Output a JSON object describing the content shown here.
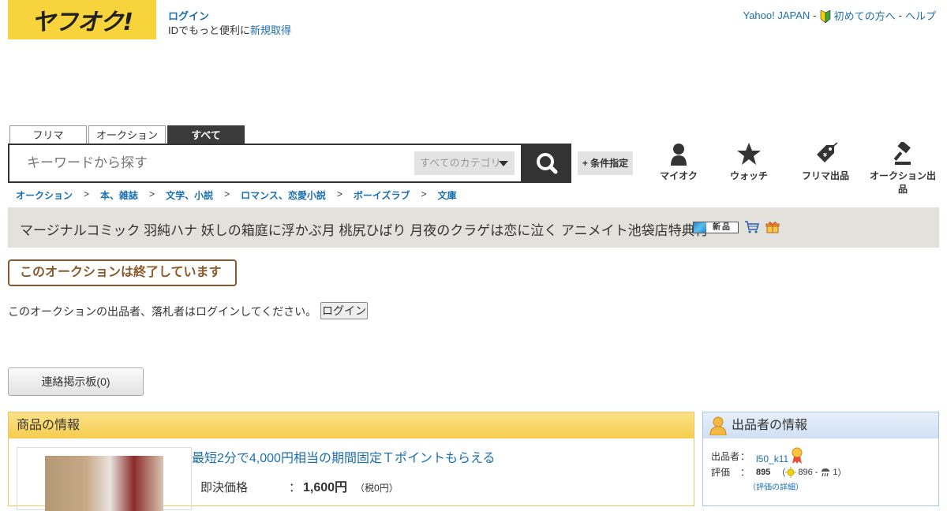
{
  "header": {
    "logo_text": "ヤフオク!",
    "login_label": "ログイン",
    "login_sub_text": "IDでもっと便利に",
    "register_label": "新規取得",
    "yahoo_japan_label": "Yahoo! JAPAN",
    "beginner_label": "初めての方へ",
    "help_label": "ヘルプ",
    "separator": "-"
  },
  "search": {
    "tabs": [
      "フリマ",
      "オークション",
      "すべて"
    ],
    "active_tab": "すべて",
    "placeholder": "キーワードから探す",
    "category_select": "すべてのカテゴリ",
    "condition_button": "+ 条件指定"
  },
  "nav_icons": [
    {
      "label": "マイオク",
      "icon": "person-icon"
    },
    {
      "label": "ウォッチ",
      "icon": "star-icon"
    },
    {
      "label": "フリマ出品",
      "icon": "tag-icon"
    },
    {
      "label": "オークション出品",
      "icon": "gavel-icon"
    }
  ],
  "breadcrumb": [
    "オークション",
    "本、雑誌",
    "文学、小説",
    "ロマンス、恋愛小説",
    "ボーイズラブ",
    "文庫"
  ],
  "breadcrumb_sep": ">",
  "item": {
    "title": "マージナルコミック 羽純ハナ 妖しの箱庭に浮かぶ月 桃尻ひばり 月夜のクラゲは恋に泣く アニメイト池袋店特典付",
    "new_badge": "新品",
    "ended_label": "このオークションは終了しています",
    "login_message": "このオークションの出品者、落札者はログインしてください。",
    "login_button": "ログイン",
    "board_button": "連絡掲示板(0)"
  },
  "product_info": {
    "heading": "商品の情報",
    "promo_link": "最短2分で4,000円相当の期間固定Ｔポイントもらえる",
    "price_label": "即決価格",
    "colon": "：",
    "price_value": "1,600円",
    "tax_note": "（税0円）"
  },
  "seller": {
    "heading": "出品者の情報",
    "seller_label": "出品者",
    "seller_name": "l50_k11",
    "rating_label": "評価",
    "rating_value": "895",
    "rating_good": "896",
    "rating_bad": "1",
    "rating_detail_link": "（評価の詳細）",
    "colon": "："
  },
  "colors": {
    "logo_bg": "#f7d33c",
    "link": "#1a6fb0",
    "ended_border": "#8b5a2b",
    "product_header": "#f6cc4e",
    "seller_header": "#cfe0f4"
  }
}
